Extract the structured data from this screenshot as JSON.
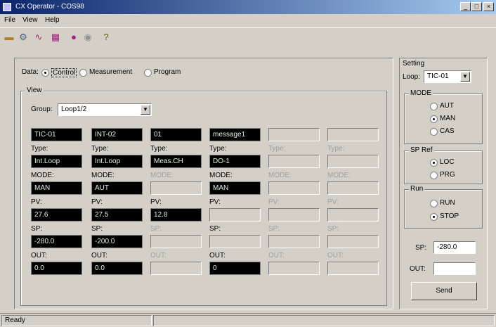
{
  "window": {
    "title": "CX Operator - COS98",
    "minimize": "_",
    "maximize": "□",
    "close": "×"
  },
  "menu": [
    "File",
    "View",
    "Help"
  ],
  "toolbar_icons": [
    "open-icon",
    "settings-icon",
    "plot-icon",
    "chart-icon",
    "badge-icon",
    "record-icon",
    "help-icon"
  ],
  "data": {
    "label": "Data:",
    "options": [
      "Control",
      "Measurement",
      "Program"
    ],
    "selected": "Control"
  },
  "view": {
    "title": "View",
    "group_label": "Group:",
    "group_value": "Loop1/2"
  },
  "columns": [
    {
      "tag": "TIC-01",
      "type": "Int.Loop",
      "mode": "MAN",
      "pv": "27.6",
      "sp": "-280.0",
      "out": "0.0",
      "active": true,
      "mode_active": true
    },
    {
      "tag": "INT-02",
      "type": "Int.Loop",
      "mode": "AUT",
      "pv": "27.5",
      "sp": "-200.0",
      "out": "0.0",
      "active": true,
      "mode_active": true
    },
    {
      "tag": "01",
      "type": "Meas.CH",
      "mode": "",
      "pv": "12.8",
      "sp": "",
      "out": "",
      "active": true,
      "mode_active": false
    },
    {
      "tag": "message1",
      "type": "DO-1",
      "mode": "MAN",
      "pv": "",
      "sp": "",
      "out": "0",
      "active": true,
      "mode_active": true
    },
    {
      "tag": "",
      "type": "",
      "mode": "",
      "pv": "",
      "sp": "",
      "out": "",
      "active": false,
      "mode_active": false
    },
    {
      "tag": "",
      "type": "",
      "mode": "",
      "pv": "",
      "sp": "",
      "out": "",
      "active": false,
      "mode_active": false
    }
  ],
  "row_labels": {
    "type": "Type:",
    "mode": "MODE:",
    "pv": "PV:",
    "sp": "SP:",
    "out": "OUT:"
  },
  "setting": {
    "title": "Setting",
    "loop_label": "Loop:",
    "loop_value": "TIC-01",
    "mode": {
      "title": "MODE",
      "options": [
        "AUT",
        "MAN",
        "CAS"
      ],
      "selected": "MAN"
    },
    "sp_ref": {
      "title": "SP Ref",
      "options": [
        "LOC",
        "PRG"
      ],
      "selected": "LOC"
    },
    "run": {
      "title": "Run",
      "options": [
        "RUN",
        "STOP"
      ],
      "selected": "STOP"
    },
    "sp_label": "SP:",
    "sp_value": "-280.0",
    "out_label": "OUT:",
    "out_value": "",
    "send_button": "Send"
  },
  "status": {
    "text": "Ready"
  }
}
